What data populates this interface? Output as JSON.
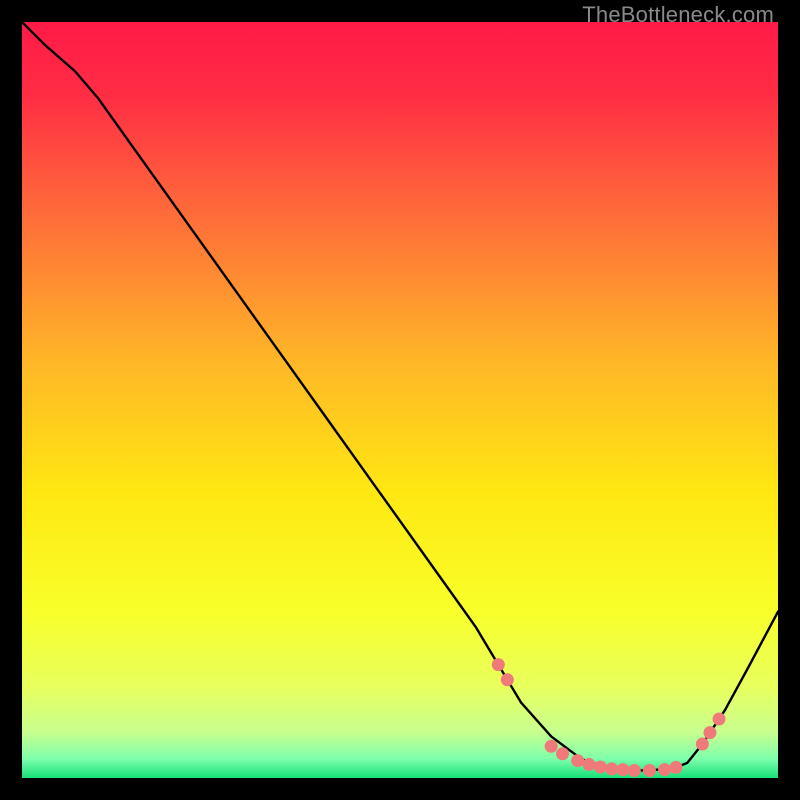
{
  "watermark": "TheBottleneck.com",
  "chart_data": {
    "type": "line",
    "title": "",
    "xlabel": "",
    "ylabel": "",
    "xlim": [
      0,
      100
    ],
    "ylim": [
      0,
      100
    ],
    "background_gradient": {
      "stops": [
        {
          "offset": 0.0,
          "color": "#ff1a47"
        },
        {
          "offset": 0.1,
          "color": "#ff2e44"
        },
        {
          "offset": 0.25,
          "color": "#ff6a3a"
        },
        {
          "offset": 0.45,
          "color": "#ffb727"
        },
        {
          "offset": 0.62,
          "color": "#ffe712"
        },
        {
          "offset": 0.78,
          "color": "#f8ff2a"
        },
        {
          "offset": 0.88,
          "color": "#e8ff5e"
        },
        {
          "offset": 0.94,
          "color": "#c7ff8f"
        },
        {
          "offset": 0.975,
          "color": "#7dffab"
        },
        {
          "offset": 1.0,
          "color": "#16e07a"
        }
      ]
    },
    "series": [
      {
        "name": "bottleneck-curve",
        "color": "#000000",
        "x": [
          0.0,
          3.0,
          7.0,
          10.0,
          15.0,
          20.0,
          25.0,
          30.0,
          35.0,
          40.0,
          45.0,
          50.0,
          55.0,
          60.0,
          63.0,
          66.0,
          70.0,
          74.0,
          78.0,
          82.0,
          86.0,
          88.0,
          90.0,
          93.0,
          96.0,
          100.0
        ],
        "y": [
          100.0,
          97.0,
          93.5,
          90.0,
          83.0,
          76.0,
          69.0,
          62.0,
          55.0,
          48.0,
          41.0,
          34.0,
          27.0,
          20.0,
          15.0,
          10.0,
          5.5,
          2.5,
          1.2,
          1.0,
          1.2,
          2.0,
          4.5,
          9.0,
          14.5,
          22.0
        ]
      }
    ],
    "markers": {
      "name": "highlight-points",
      "color": "#f07a7a",
      "radius": 6.5,
      "points": [
        {
          "x": 63.0,
          "y": 15.0
        },
        {
          "x": 64.2,
          "y": 13.0
        },
        {
          "x": 70.0,
          "y": 4.2
        },
        {
          "x": 71.5,
          "y": 3.2
        },
        {
          "x": 73.5,
          "y": 2.3
        },
        {
          "x": 75.0,
          "y": 1.8
        },
        {
          "x": 76.5,
          "y": 1.45
        },
        {
          "x": 78.0,
          "y": 1.2
        },
        {
          "x": 79.5,
          "y": 1.1
        },
        {
          "x": 81.0,
          "y": 1.0
        },
        {
          "x": 83.0,
          "y": 1.0
        },
        {
          "x": 85.0,
          "y": 1.1
        },
        {
          "x": 86.5,
          "y": 1.4
        },
        {
          "x": 90.0,
          "y": 4.5
        },
        {
          "x": 91.0,
          "y": 6.0
        },
        {
          "x": 92.2,
          "y": 7.8
        }
      ]
    }
  }
}
